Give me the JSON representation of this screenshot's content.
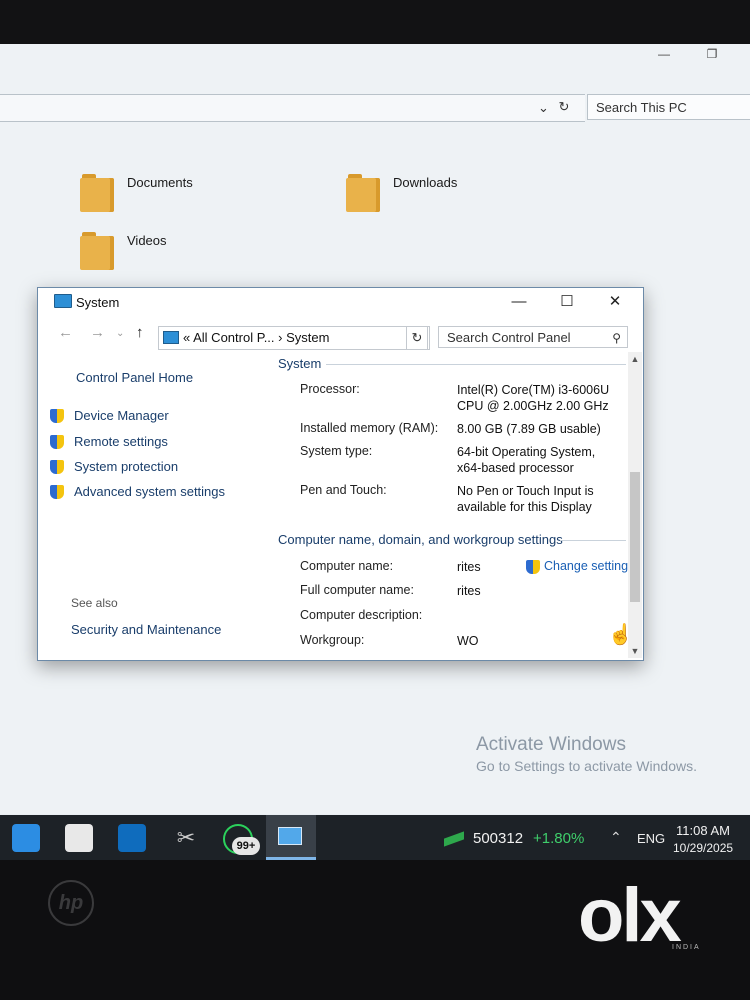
{
  "explorer": {
    "search_placeholder": "Search This PC",
    "folders": [
      "Documents",
      "Downloads",
      "Videos"
    ]
  },
  "system_window": {
    "title": "System",
    "breadcrumb": "«  All Control P...  ›  System",
    "search_placeholder": "Search Control Panel",
    "left_pane": {
      "home": "Control Panel Home",
      "items": [
        "Device Manager",
        "Remote settings",
        "System protection",
        "Advanced system settings"
      ],
      "see_also": "See also",
      "see_also_items": [
        "Security and Maintenance"
      ]
    },
    "system_section": {
      "title": "System",
      "rows": [
        {
          "label": "Processor:",
          "value": "Intel(R) Core(TM) i3-6006U CPU @ 2.00GHz   2.00 GHz"
        },
        {
          "label": "Installed memory (RAM):",
          "value": "8.00 GB (7.89 GB usable)"
        },
        {
          "label": "System type:",
          "value": "64-bit Operating System, x64-based processor"
        },
        {
          "label": "Pen and Touch:",
          "value": "No Pen or Touch Input is available for this Display"
        }
      ]
    },
    "computer_section": {
      "title": "Computer name, domain, and workgroup settings",
      "rows": [
        {
          "label": "Computer name:",
          "value": "rites"
        },
        {
          "label": "Full computer name:",
          "value": "rites"
        },
        {
          "label": "Computer description:",
          "value": ""
        },
        {
          "label": "Workgroup:",
          "value": "WO"
        }
      ],
      "change_settings": "Change settings"
    }
  },
  "watermark": {
    "line1": "Activate Windows",
    "line2": "Go to Settings to activate Windows."
  },
  "taskbar": {
    "badge": "99+",
    "stock_value": "500312",
    "stock_change": "+1.80%",
    "language": "ENG",
    "time": "11:08 AM",
    "date": "10/29/2025"
  },
  "overlay": {
    "brand": "olx",
    "brand_sub": "INDIA",
    "laptop_logo": "hp"
  }
}
